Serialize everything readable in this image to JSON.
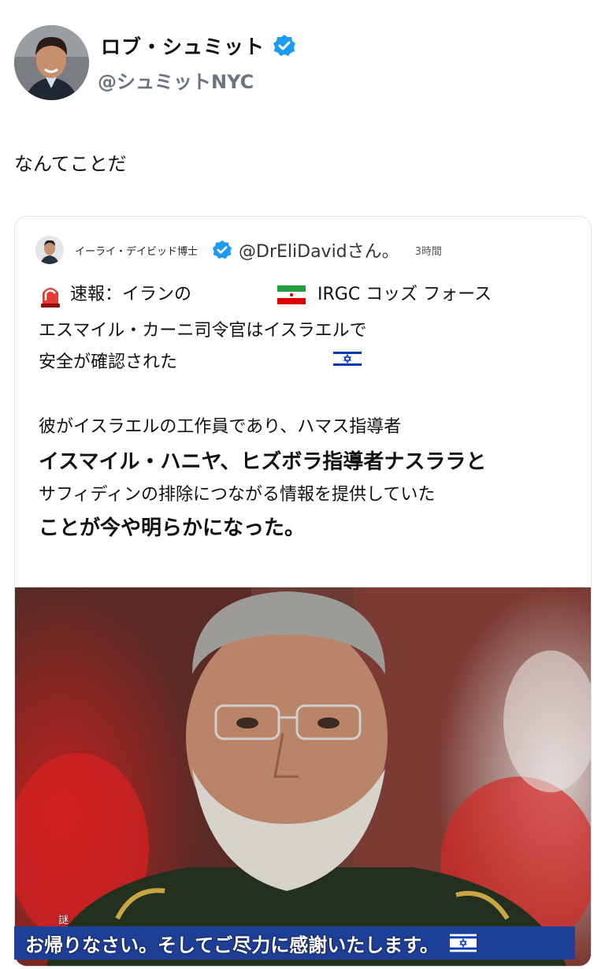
{
  "author": {
    "display_name": "ロブ・シュミット",
    "handle": "@シュミットNYC",
    "verified_icon": "verified-badge-icon",
    "avatar_icon": "avatar"
  },
  "tweet": {
    "text": "なんてことだ"
  },
  "quoted": {
    "name": "イーライ・デイビッド博士",
    "handle": "@DrEliDavidさん。",
    "time": "3時間",
    "lines": [
      "速報：イランの",
      "IRGC コッズ フォース",
      "エスマイル・カーニ司令官はイスラエルで",
      "安全が確認された",
      "彼がイスラエルの工作員であり、ハマス指導者",
      "イスマイル・ハニヤ、ヒズボラ指導者ナスララと",
      "サフィディンの排除につながる情報を提供していた",
      "ことが今や明らかになった。"
    ],
    "icons": [
      "siren-icon",
      "iran-flag-icon",
      "israel-flag-icon"
    ]
  },
  "media": {
    "caption": "お帰りなさい。そしてご尽力に感謝いたします。",
    "corner_mark": "謎"
  },
  "colors": {
    "verified": "#1d9bf0",
    "handle_gray": "#6b7480",
    "caption_bar": "#1e3f96"
  }
}
